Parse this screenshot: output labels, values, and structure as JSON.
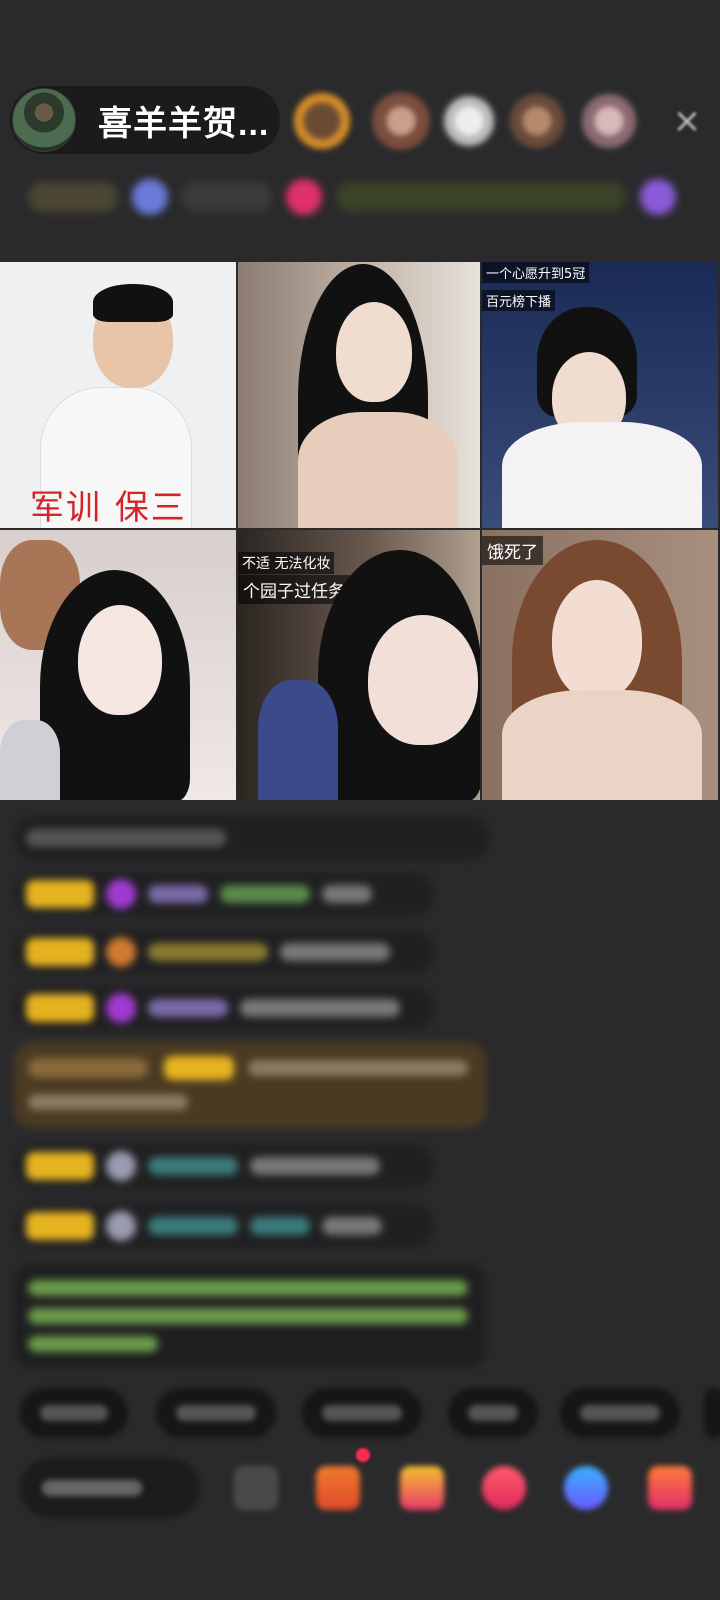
{
  "header": {
    "host_name": "喜羊羊贺...",
    "close_icon": "×"
  },
  "video_grid": {
    "tiles": [
      {
        "caption": "军训  保三"
      },
      {
        "caption": ""
      },
      {
        "caption_top": "一个心愿升到5冠",
        "caption_sub": "百元榜下播"
      },
      {
        "caption": ""
      },
      {
        "caption_top": "不适  无法化妆",
        "caption_sub": "个园子过任务"
      },
      {
        "caption_top": "饿死了"
      }
    ]
  },
  "colors": {
    "background": "#2a2a2c",
    "badge_gold": "#e6b320",
    "caption_red": "#d4242a",
    "chat_green": "#8ec85a",
    "chat_teal": "#4fb7b3"
  },
  "icons": [
    "host-avatar",
    "close-icon",
    "gem-icon",
    "gift-icon",
    "emoji-icon"
  ]
}
